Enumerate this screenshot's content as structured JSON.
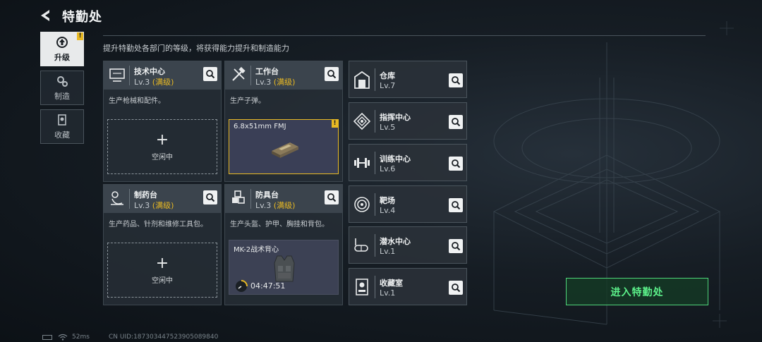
{
  "header": {
    "title": "特勤处"
  },
  "subtitle": "提升特勤处各部门的等级，将获得能力提升和制造能力",
  "nav": [
    {
      "label": "升级",
      "icon": "upgrade-icon",
      "active": true,
      "badge": "!"
    },
    {
      "label": "制造",
      "icon": "gears-icon",
      "active": false
    },
    {
      "label": "收藏",
      "icon": "collection-icon",
      "active": false
    }
  ],
  "departments": [
    {
      "name": "技术中心",
      "level": "Lv.3",
      "maxed": "(满级)",
      "desc": "生产枪械和配件。",
      "icon": "tech-center-icon",
      "slot": {
        "type": "idle",
        "label": "空闲中"
      }
    },
    {
      "name": "工作台",
      "level": "Lv.3",
      "maxed": "(满级)",
      "desc": "生产子弹。",
      "icon": "workbench-icon",
      "slot": {
        "type": "ready",
        "item": "6.8x51mm FMJ",
        "badge": "!"
      }
    },
    {
      "name": "制药台",
      "level": "Lv.3",
      "maxed": "(满级)",
      "desc": "生产药品、针剂和维修工具包。",
      "icon": "pharmacy-icon",
      "slot": {
        "type": "idle",
        "label": "空闲中"
      }
    },
    {
      "name": "防具台",
      "level": "Lv.3",
      "maxed": "(满级)",
      "desc": "生产头盔、护甲、胸挂和背包。",
      "icon": "armor-icon",
      "slot": {
        "type": "progress",
        "item": "MK-2战术背心",
        "timer": "04:47:51"
      }
    }
  ],
  "facilities": [
    {
      "name": "仓库",
      "level": "Lv.7",
      "icon": "warehouse-icon"
    },
    {
      "name": "指挥中心",
      "level": "Lv.5",
      "icon": "command-center-icon"
    },
    {
      "name": "训练中心",
      "level": "Lv.6",
      "icon": "dumbbell-icon"
    },
    {
      "name": "靶场",
      "level": "Lv.4",
      "icon": "target-icon"
    },
    {
      "name": "潜水中心",
      "level": "Lv.1",
      "icon": "diving-mask-icon"
    },
    {
      "name": "收藏室",
      "level": "Lv.1",
      "icon": "collection-room-icon"
    }
  ],
  "enter_button": "进入特勤处",
  "status": {
    "ping": "52ms",
    "uid": "CN UID:187303447523905089840"
  },
  "colors": {
    "accent_gold": "#e8b923",
    "accent_green": "#5cf08a",
    "panel": "#262d35"
  }
}
